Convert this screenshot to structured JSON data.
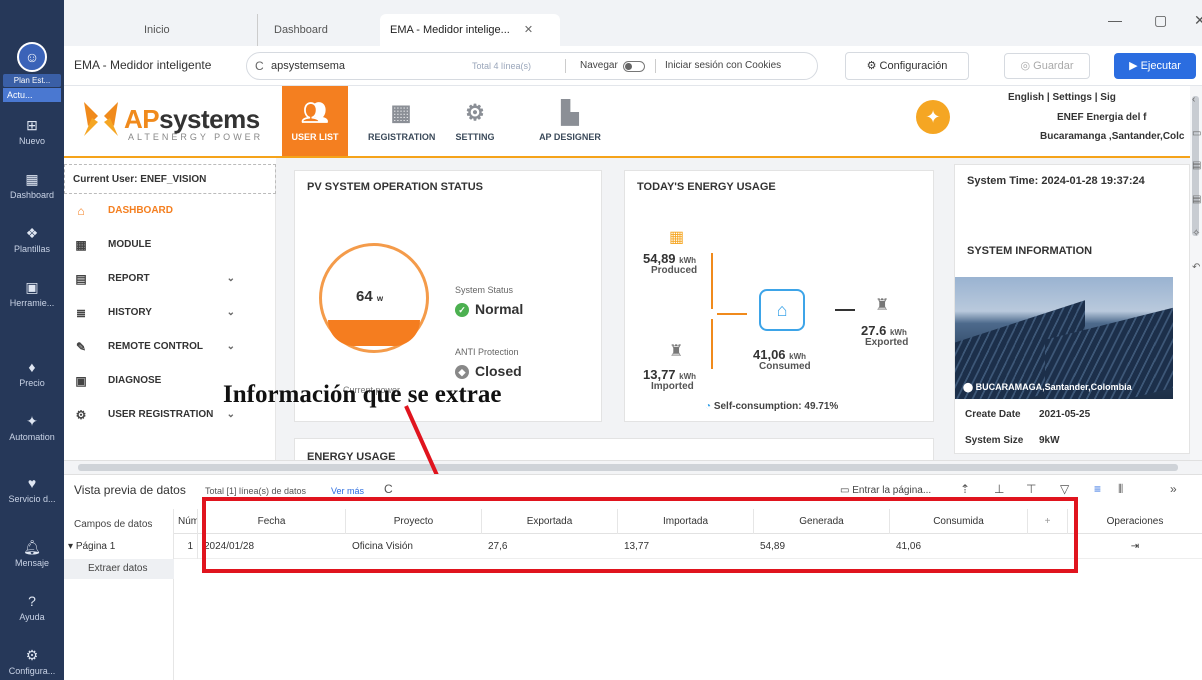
{
  "rail": {
    "profile_label": "Plan Est...",
    "active_label": "Actu...",
    "items": [
      {
        "label": "Nuevo",
        "icon": "plus-icon"
      },
      {
        "label": "Dashboard",
        "icon": "dashboard-icon"
      },
      {
        "label": "Plantillas",
        "icon": "templates-icon"
      },
      {
        "label": "Herramie...",
        "icon": "tools-icon"
      },
      {
        "label": "Precio",
        "icon": "price-icon"
      },
      {
        "label": "Automation",
        "icon": "automation-icon"
      },
      {
        "label": "Servicio d...",
        "icon": "service-icon"
      },
      {
        "label": "Mensaje",
        "icon": "bell-icon"
      },
      {
        "label": "Ayuda",
        "icon": "help-icon"
      },
      {
        "label": "Configura...",
        "icon": "gear-icon"
      }
    ]
  },
  "tabs": [
    {
      "label": "Inicio"
    },
    {
      "label": "Dashboard"
    },
    {
      "label": "EMA - Medidor intelige...",
      "active": true
    }
  ],
  "address": {
    "app_title": "EMA - Medidor inteligente",
    "url": "apsystemsema",
    "total": "Total 4 línea(s)",
    "navegar": "Navegar",
    "cookies": "Iniciar sesión con Cookies",
    "configuracion": "Configuración",
    "guardar": "Guardar",
    "ejecutar": "Ejecutar"
  },
  "site": {
    "brand_ap": "AP",
    "brand_rest": "systems",
    "brand_sub": "ALTENERGY POWER",
    "nav": [
      {
        "label": "USER LIST",
        "icon": "user-list-icon",
        "active": true
      },
      {
        "label": "REGISTRATION",
        "icon": "registration-icon"
      },
      {
        "label": "SETTING",
        "icon": "setting-icon"
      },
      {
        "label": "AP DESIGNER",
        "icon": "designer-icon"
      }
    ],
    "top_links": "English   |   Settings   |   Sig",
    "company": "ENEF Energia del f",
    "city": "Bucaramanga ,Santander,Colc"
  },
  "menu": {
    "current_user": "Current User: ENEF_VISION",
    "items": [
      {
        "label": "DASHBOARD",
        "icon": "home-icon",
        "active": true
      },
      {
        "label": "MODULE",
        "icon": "module-icon"
      },
      {
        "label": "REPORT",
        "icon": "report-icon",
        "chevron": true
      },
      {
        "label": "HISTORY",
        "icon": "history-icon",
        "chevron": true
      },
      {
        "label": "REMOTE CONTROL",
        "icon": "wrench-icon",
        "chevron": true
      },
      {
        "label": "DIAGNOSE",
        "icon": "diagnose-icon"
      },
      {
        "label": "USER REGISTRATION",
        "icon": "user-registration-icon",
        "chevron": true
      }
    ]
  },
  "pv": {
    "title": "PV SYSTEM OPERATION STATUS",
    "power": "64",
    "power_unit": "w",
    "current_power": "Current power",
    "status_label": "System Status",
    "status_value": "Normal",
    "anti_label": "ANTI Protection",
    "anti_value": "Closed"
  },
  "energy": {
    "title": "TODAY'S ENERGY USAGE",
    "produced": "54,89",
    "produced_label": "Produced",
    "imported": "13,77",
    "imported_label": "Imported",
    "consumed": "41,06",
    "consumed_label": "Consumed",
    "exported": "27.6",
    "exported_label": "Exported",
    "unit": "kWh",
    "self_consumption": "Self-consumption: 49.71%"
  },
  "energy_usage_title": "ENERGY USAGE",
  "system": {
    "time": "System Time: 2024-01-28 19:37:24",
    "info_title": "SYSTEM INFORMATION",
    "location": "BUCARAMAGA,Santander,Colombia",
    "create_label": "Create Date",
    "create_value": "2021-05-25",
    "size_label": "System Size",
    "size_value": "9kW"
  },
  "annotation": "Información que se extrae",
  "preview": {
    "title": "Vista previa de datos",
    "total": "Total [1] línea(s) de datos",
    "ver_mas": "Ver más",
    "entrar": "Entrar la página...",
    "fields_header": "Campos de datos",
    "page": "Página 1",
    "extract": "Extraer datos",
    "columns": [
      "Núm",
      "Fecha",
      "Proyecto",
      "Exportada",
      "Importada",
      "Generada",
      "Consumida",
      "+",
      "Operaciones"
    ],
    "rows": [
      [
        "1",
        "2024/01/28",
        "Oficina Visión",
        "27,6",
        "13,77",
        "54,89",
        "41,06",
        "",
        ""
      ]
    ]
  }
}
